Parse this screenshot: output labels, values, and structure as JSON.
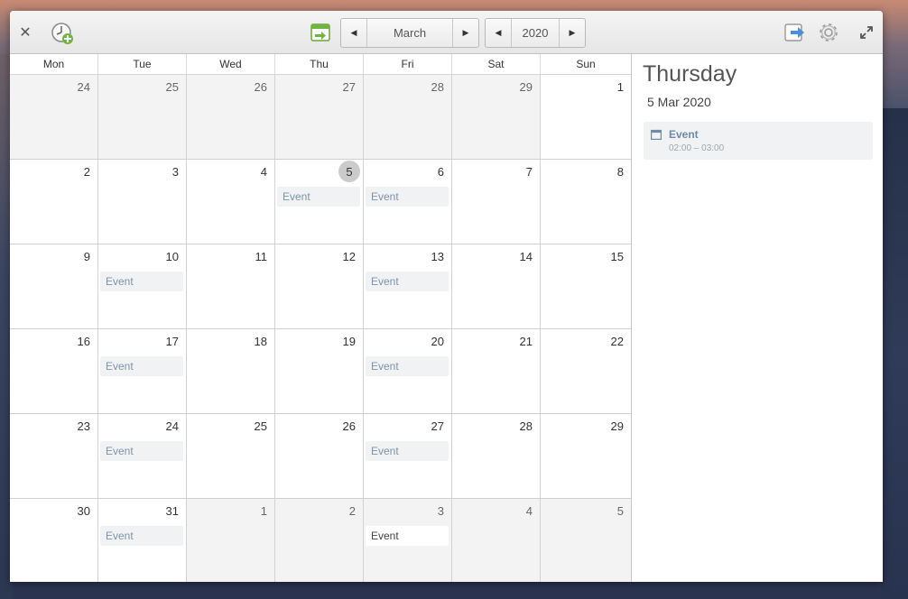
{
  "window": {
    "toolbar": {
      "close_icon": "close-icon",
      "add_event_icon": "clock-add-icon",
      "today_icon": "calendar-today-icon",
      "export_icon": "export-arrow-icon",
      "settings_icon": "gear-icon",
      "fullscreen_icon": "fullscreen-icon",
      "month": "March",
      "year": "2020"
    }
  },
  "calendar": {
    "weekdays": [
      "Mon",
      "Tue",
      "Wed",
      "Thu",
      "Fri",
      "Sat",
      "Sun"
    ],
    "weeks": [
      [
        {
          "day": "24",
          "current": false
        },
        {
          "day": "25",
          "current": false
        },
        {
          "day": "26",
          "current": false
        },
        {
          "day": "27",
          "current": false
        },
        {
          "day": "28",
          "current": false
        },
        {
          "day": "29",
          "current": false
        },
        {
          "day": "1",
          "current": true
        }
      ],
      [
        {
          "day": "2",
          "current": true
        },
        {
          "day": "3",
          "current": true
        },
        {
          "day": "4",
          "current": true
        },
        {
          "day": "5",
          "current": true,
          "today": true,
          "event": "Event"
        },
        {
          "day": "6",
          "current": true,
          "event": "Event"
        },
        {
          "day": "7",
          "current": true
        },
        {
          "day": "8",
          "current": true
        }
      ],
      [
        {
          "day": "9",
          "current": true
        },
        {
          "day": "10",
          "current": true,
          "event": "Event"
        },
        {
          "day": "11",
          "current": true
        },
        {
          "day": "12",
          "current": true
        },
        {
          "day": "13",
          "current": true,
          "event": "Event"
        },
        {
          "day": "14",
          "current": true
        },
        {
          "day": "15",
          "current": true
        }
      ],
      [
        {
          "day": "16",
          "current": true
        },
        {
          "day": "17",
          "current": true,
          "event": "Event"
        },
        {
          "day": "18",
          "current": true
        },
        {
          "day": "19",
          "current": true
        },
        {
          "day": "20",
          "current": true,
          "event": "Event"
        },
        {
          "day": "21",
          "current": true
        },
        {
          "day": "22",
          "current": true
        }
      ],
      [
        {
          "day": "23",
          "current": true
        },
        {
          "day": "24",
          "current": true,
          "event": "Event"
        },
        {
          "day": "25",
          "current": true
        },
        {
          "day": "26",
          "current": true
        },
        {
          "day": "27",
          "current": true,
          "event": "Event"
        },
        {
          "day": "28",
          "current": true
        },
        {
          "day": "29",
          "current": true
        }
      ],
      [
        {
          "day": "30",
          "current": true
        },
        {
          "day": "31",
          "current": true,
          "event": "Event"
        },
        {
          "day": "1",
          "current": false
        },
        {
          "day": "2",
          "current": false
        },
        {
          "day": "3",
          "current": false,
          "event": "Event"
        },
        {
          "day": "4",
          "current": false
        },
        {
          "day": "5",
          "current": false
        }
      ]
    ]
  },
  "sidebar": {
    "weekday": "Thursday",
    "date": "5 Mar 2020",
    "events": [
      {
        "title": "Event",
        "time": "02:00 – 03:00",
        "icon": "calendar-icon"
      }
    ]
  },
  "colors": {
    "event_text": "#7d93a8",
    "event_bg": "#f1f2f4",
    "today_circle": "#cbcbcb",
    "accent_green": "#6fb63f",
    "accent_blue": "#4a90d9"
  }
}
